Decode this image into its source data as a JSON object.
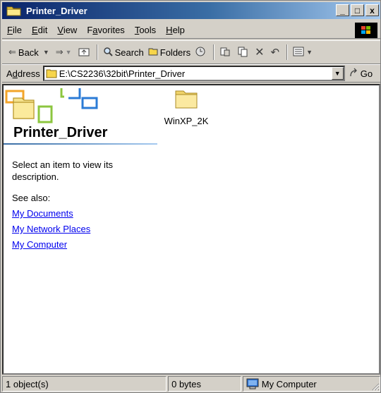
{
  "window": {
    "title": "Printer_Driver",
    "buttons": {
      "minimize": "_",
      "maximize": "□",
      "close": "x"
    }
  },
  "menu": [
    "File",
    "Edit",
    "View",
    "Favorites",
    "Tools",
    "Help"
  ],
  "menu_underline": [
    "F",
    "E",
    "V",
    "a",
    "T",
    "H"
  ],
  "toolbar": {
    "back_label": "Back",
    "search_label": "Search",
    "folders_label": "Folders"
  },
  "address": {
    "label_prefix": "A",
    "label_underline": "d",
    "label_suffix": "dress",
    "value": "E:\\CS2236\\32bit\\Printer_Driver",
    "go_label": "Go"
  },
  "left_pane": {
    "folder_title": "Printer_Driver",
    "description": "Select an item to view its description.",
    "see_also": "See also:",
    "links": [
      "My Documents",
      "My Network Places",
      "My Computer"
    ]
  },
  "files": [
    {
      "name": "WinXP_2K",
      "type": "folder"
    }
  ],
  "status": {
    "objects": "1 object(s)",
    "size": "0 bytes",
    "zone": "My Computer"
  },
  "colors": {
    "titlebar_start": "#0a246a",
    "titlebar_end": "#a6caf0",
    "chrome": "#d4d0c8",
    "link": "#0000ee",
    "folder": "#f7e08a"
  }
}
